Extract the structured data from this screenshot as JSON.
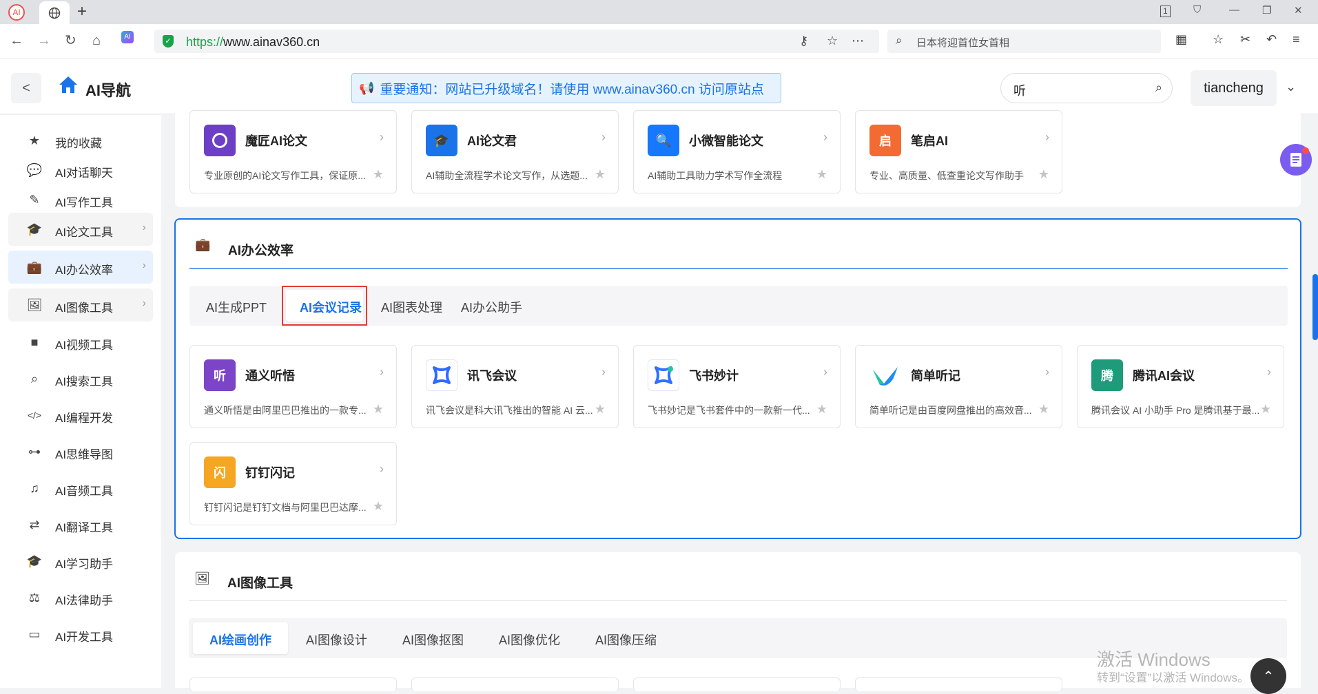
{
  "browser": {
    "tab_logo": "AI",
    "tab_globe": "globe-icon",
    "new_tab": "+",
    "url_scheme": "https://",
    "url_host": "www.ainav360.cn",
    "search_placeholder": "日本将迎首位女首相",
    "window_controls": [
      "1",
      "⛉",
      "—",
      "❐",
      "✕"
    ]
  },
  "header": {
    "back": "<",
    "brand": "AI导航",
    "notice": "重要通知：网站已升级域名！请使用 www.ainav360.cn 访问原站点",
    "search_value": "听",
    "username": "tiancheng",
    "caret": "⌄"
  },
  "sidebar": {
    "items": [
      {
        "label": "我的收藏",
        "icon": "star-icon",
        "glyph": "★"
      },
      {
        "label": "AI对话聊天",
        "icon": "chat-icon",
        "glyph": "💬"
      },
      {
        "label": "AI写作工具",
        "icon": "pencil-icon",
        "glyph": "✎"
      },
      {
        "label": "AI论文工具",
        "icon": "graduation-cap-icon",
        "glyph": "🎓"
      },
      {
        "label": "AI办公效率",
        "icon": "briefcase-icon",
        "glyph": "💼"
      },
      {
        "label": "AI图像工具",
        "icon": "image-icon",
        "glyph": "🖼"
      },
      {
        "label": "AI视频工具",
        "icon": "video-icon",
        "glyph": "■"
      },
      {
        "label": "AI搜索工具",
        "icon": "search-icon",
        "glyph": "⌕"
      },
      {
        "label": "AI编程开发",
        "icon": "code-icon",
        "glyph": "</>"
      },
      {
        "label": "AI思维导图",
        "icon": "mindmap-icon",
        "glyph": "⊶"
      },
      {
        "label": "AI音频工具",
        "icon": "music-icon",
        "glyph": "♫"
      },
      {
        "label": "AI翻译工具",
        "icon": "translate-icon",
        "glyph": "⇄"
      },
      {
        "label": "AI学习助手",
        "icon": "graduation-cap-icon",
        "glyph": "🎓"
      },
      {
        "label": "AI法律助手",
        "icon": "gavel-icon",
        "glyph": "⚖"
      },
      {
        "label": "AI开发工具",
        "icon": "terminal-icon",
        "glyph": "▭"
      }
    ]
  },
  "paper_section": {
    "cards": [
      {
        "name": "魔匠AI论文",
        "desc": "专业原创的AI论文写作工具，保证原...",
        "logo": "",
        "color": "#6d3fc7"
      },
      {
        "name": "AI论文君",
        "desc": "AI辅助全流程学术论文写作，从选题...",
        "logo": "🎓",
        "color": "#1a73e8"
      },
      {
        "name": "小微智能论文",
        "desc": "AI辅助工具助力学术写作全流程",
        "logo": "🔍",
        "color": "#1677ff"
      },
      {
        "name": "笔启AI",
        "desc": "专业、高质量、低查重论文写作助手",
        "logo": "启",
        "color": "#f36b32"
      }
    ]
  },
  "office_section": {
    "title": "AI办公效率",
    "tabs": [
      "AI生成PPT",
      "AI会议记录",
      "AI图表处理",
      "AI办公助手"
    ],
    "active_tab": "AI会议记录",
    "cards": [
      {
        "name": "通义听悟",
        "desc": "通义听悟是由阿里巴巴推出的一款专...",
        "logo": "听",
        "color": "#7c45c7"
      },
      {
        "name": "讯飞会议",
        "desc": "讯飞会议是科大讯飞推出的智能 AI 云...",
        "logo": "⌘",
        "color": "#2f6bff"
      },
      {
        "name": "飞书妙计",
        "desc": "飞书妙记是飞书套件中的一款新一代...",
        "logo": "⌘",
        "color": "#3370ff"
      },
      {
        "name": "简单听记",
        "desc": "简单听记是由百度网盘推出的高效音...",
        "logo": "✓",
        "color": "#1f8df5"
      },
      {
        "name": "腾讯AI会议",
        "desc": "腾讯会议 AI 小助手 Pro 是腾讯基于最...",
        "logo": "腾",
        "color": "#1e9b7a"
      },
      {
        "name": "钉钉闪记",
        "desc": "钉钉闪记是钉钉文档与阿里巴巴达摩...",
        "logo": "闪",
        "color": "#f5a623"
      }
    ]
  },
  "image_section": {
    "title": "AI图像工具",
    "tabs": [
      "AI绘画创作",
      "AI图像设计",
      "AI图像抠图",
      "AI图像优化",
      "AI图像压缩"
    ],
    "active_tab": "AI绘画创作"
  },
  "floating": {
    "totop": "⌃"
  },
  "watermark": {
    "line1": "激活 Windows",
    "line2": "转到“设置”以激活 Windows。"
  },
  "colors": {
    "accent": "#1a73e8",
    "highlight_border": "#e53935"
  }
}
